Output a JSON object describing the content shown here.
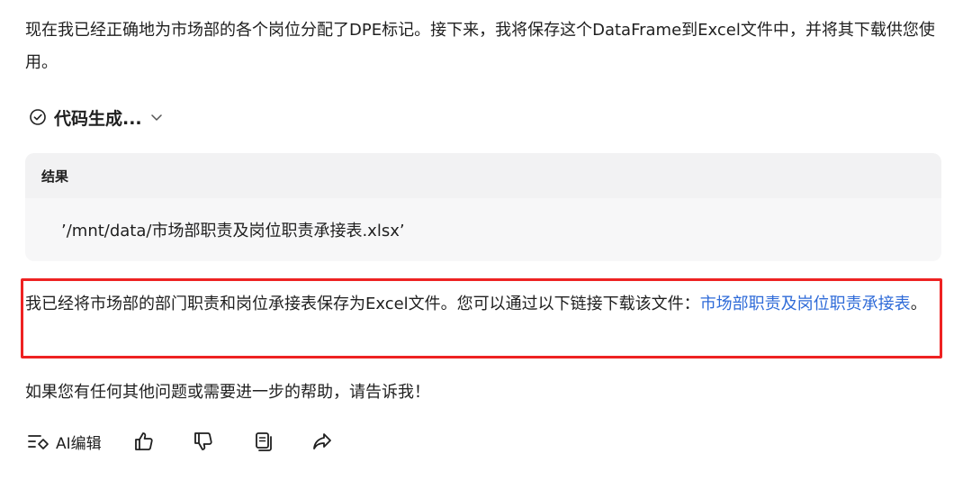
{
  "message": {
    "intro": "现在我已经正确地为市场部的各个岗位分配了DPE标记。接下来，我将保存这个DataFrame到Excel文件中，并将其下载供您使用。",
    "code_generation": {
      "label": "代码生成...",
      "status_icon": "check-circle-icon",
      "toggle_icon": "chevron-down-icon"
    },
    "result": {
      "header": "结果",
      "output": "’/mnt/data/市场部职责及岗位职责承接表.xlsx’"
    },
    "saved_text": "我已经将市场部的部门职责和岗位承接表保存为Excel文件。您可以通过以下链接下载该文件：",
    "download_link": "市场部职责及岗位职责承接表",
    "saved_suffix": "。",
    "followup": "如果您有任何其他问题或需要进一步的帮助，请告诉我！"
  },
  "actions": {
    "ai_edit_label": "AI编辑",
    "icons": [
      "ai-edit-icon",
      "thumbs-up-icon",
      "thumbs-down-icon",
      "copy-icon",
      "share-icon"
    ]
  },
  "colors": {
    "link": "#2f6bd8",
    "highlight_border": "#ee2222",
    "result_background": "#f7f7f8"
  }
}
